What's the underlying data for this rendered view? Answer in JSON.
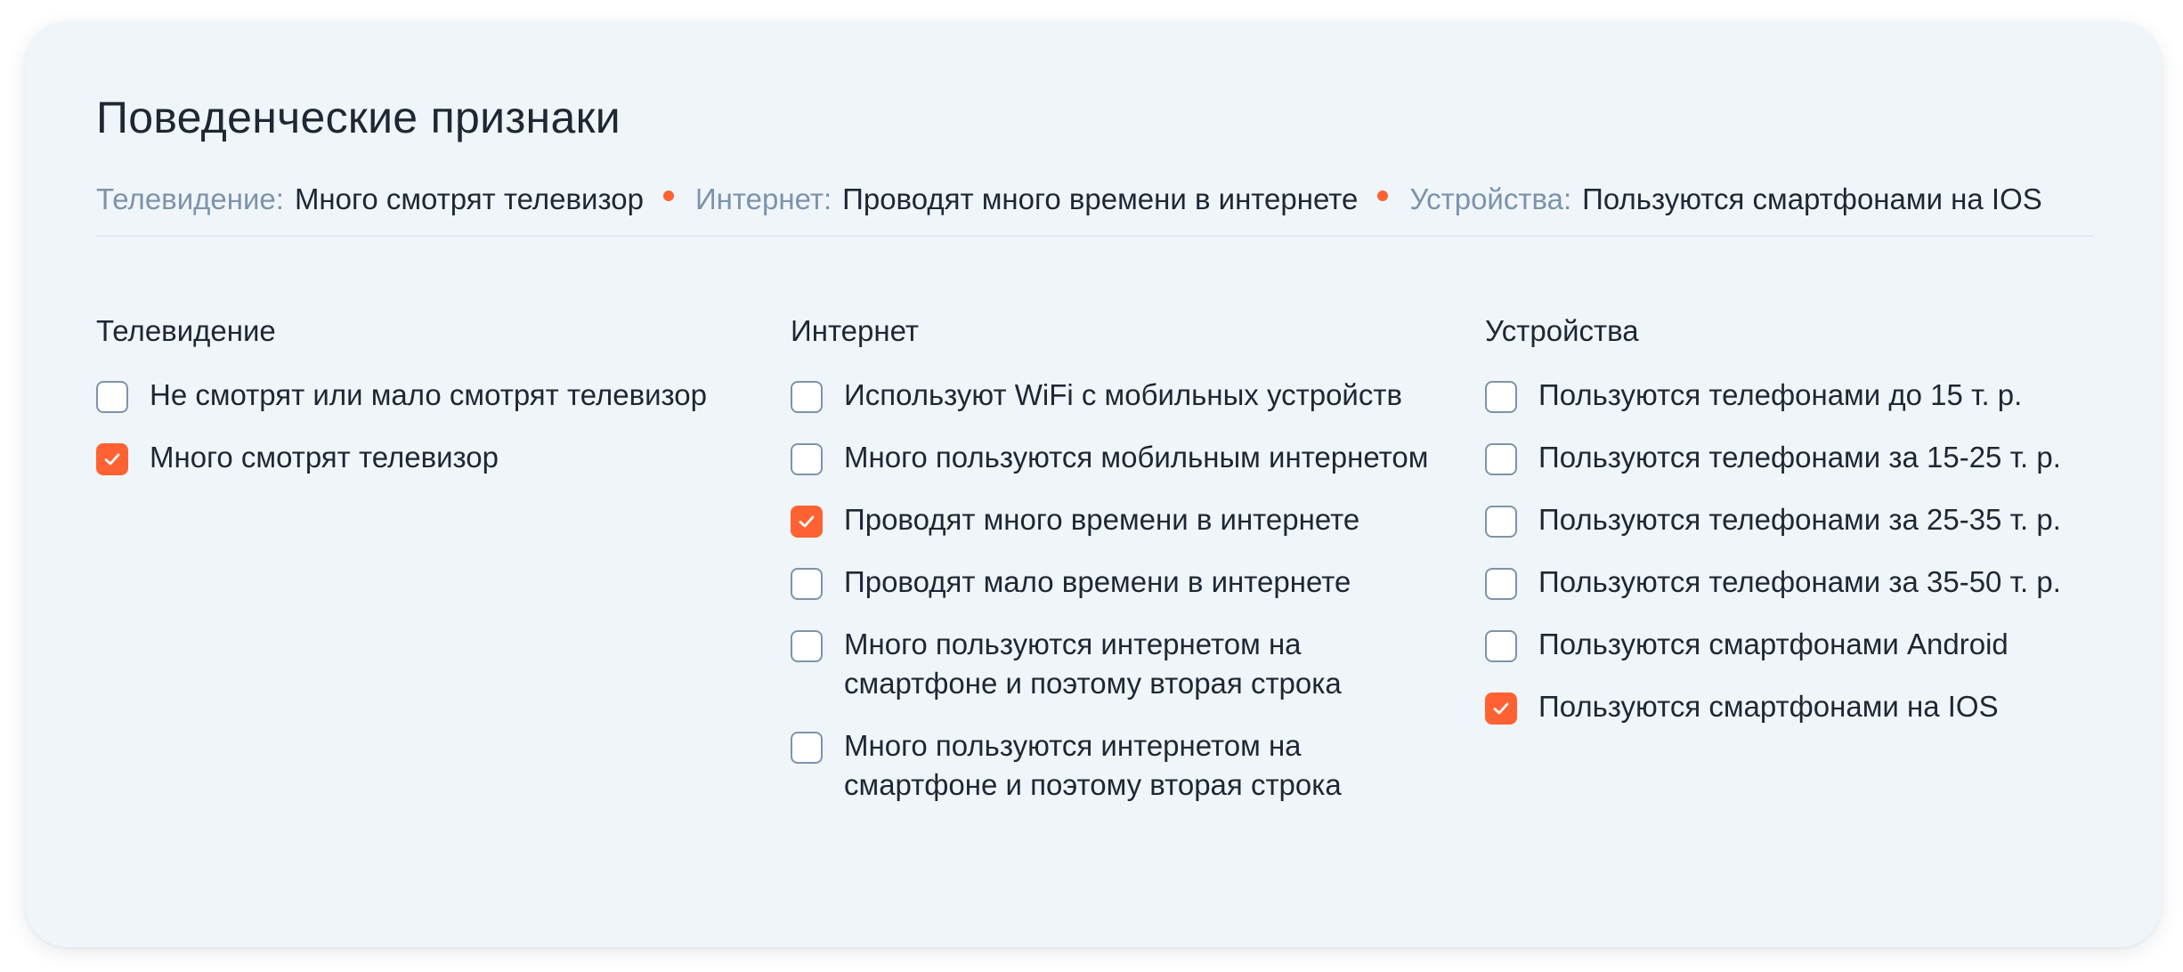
{
  "title": "Поведенческие признаки",
  "summary": [
    {
      "key": "Телевидение:",
      "value": "Много смотрят телевизор"
    },
    {
      "key": "Интернет:",
      "value": "Проводят много времени в интернете"
    },
    {
      "key": "Устройства:",
      "value": "Пользуются смартфонами на IOS"
    }
  ],
  "colors": {
    "accent": "#ff6232",
    "card_background": "#f0f5fa",
    "muted_text": "#7d93ab",
    "text": "#1f2733",
    "checkbox_border": "#7f93aa"
  },
  "columns": [
    {
      "title": "Телевидение",
      "options": [
        {
          "label": "Не смотрят или мало смотрят телевизор",
          "checked": false
        },
        {
          "label": "Много смотрят телевизор",
          "checked": true
        }
      ]
    },
    {
      "title": "Интернет",
      "options": [
        {
          "label": "Используют WiFi с мобильных устройств",
          "checked": false
        },
        {
          "label": "Много пользуются мобильным интернетом",
          "checked": false
        },
        {
          "label": "Проводят много времени в интернете",
          "checked": true
        },
        {
          "label": "Проводят мало времени в интернете",
          "checked": false
        },
        {
          "label": "Много пользуются интернетом на\nсмартфоне и поэтому вторая  строка",
          "checked": false
        },
        {
          "label": "Много пользуются интернетом на\nсмартфоне и поэтому вторая  строка",
          "checked": false
        }
      ]
    },
    {
      "title": "Устройства",
      "options": [
        {
          "label": "Пользуются телефонами до 15 т. р.",
          "checked": false
        },
        {
          "label": "Пользуются телефонами за 15-25  т. р.",
          "checked": false
        },
        {
          "label": "Пользуются телефонами за 25-35 т. р.",
          "checked": false
        },
        {
          "label": "Пользуются телефонами за 35-50 т. р.",
          "checked": false
        },
        {
          "label": "Пользуются смартфонами Android",
          "checked": false
        },
        {
          "label": "Пользуются смартфонами на IOS",
          "checked": true
        }
      ]
    }
  ]
}
